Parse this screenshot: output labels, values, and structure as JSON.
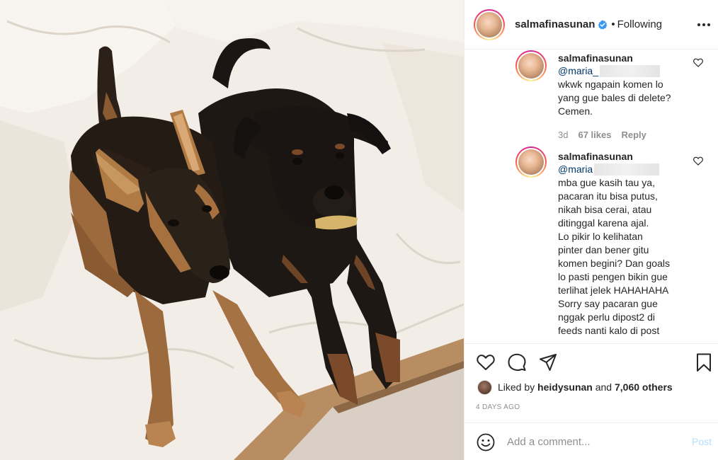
{
  "post": {
    "username": "salmafinasunan",
    "dot": "•",
    "follow_status": "Following",
    "verified": true
  },
  "comments": [
    {
      "username": "salmafinasunan",
      "mention": "@maria_",
      "lines": [
        "wkwk ngapain komen lo",
        "yang gue bales di delete?",
        "Cemen."
      ],
      "time": "3d",
      "likes": "67 likes",
      "reply": "Reply"
    },
    {
      "username": "salmafinasunan",
      "mention": "@maria",
      "lines": [
        "mba gue kasih tau ya,",
        "pacaran itu bisa putus,",
        "nikah bisa cerai, atau",
        "ditinggal karena ajal.",
        "Lo pikir lo kelihatan",
        "pinter dan bener gitu",
        "komen begini? Dan goals",
        "lo pasti pengen bikin gue",
        "terlihat jelek HAHAHAHA",
        "Sorry say pacaran gue",
        "nggak perlu dipost2 di",
        "feeds nanti kalo di post"
      ]
    }
  ],
  "likes": {
    "prefix": "Liked by",
    "user": "heidysunan",
    "conj": "and",
    "others": "7,060 others"
  },
  "date": "4 DAYS AGO",
  "add_comment": {
    "placeholder": "Add a comment...",
    "post_label": "Post"
  },
  "colors": {
    "link": "#00376b",
    "muted": "#8e8e8e",
    "post_disabled": "#b2dffc",
    "verified": "#3897f0"
  },
  "icons": [
    "more-icon",
    "heart-icon",
    "comment-icon",
    "share-icon",
    "bookmark-icon",
    "smile-icon",
    "verified-icon"
  ]
}
